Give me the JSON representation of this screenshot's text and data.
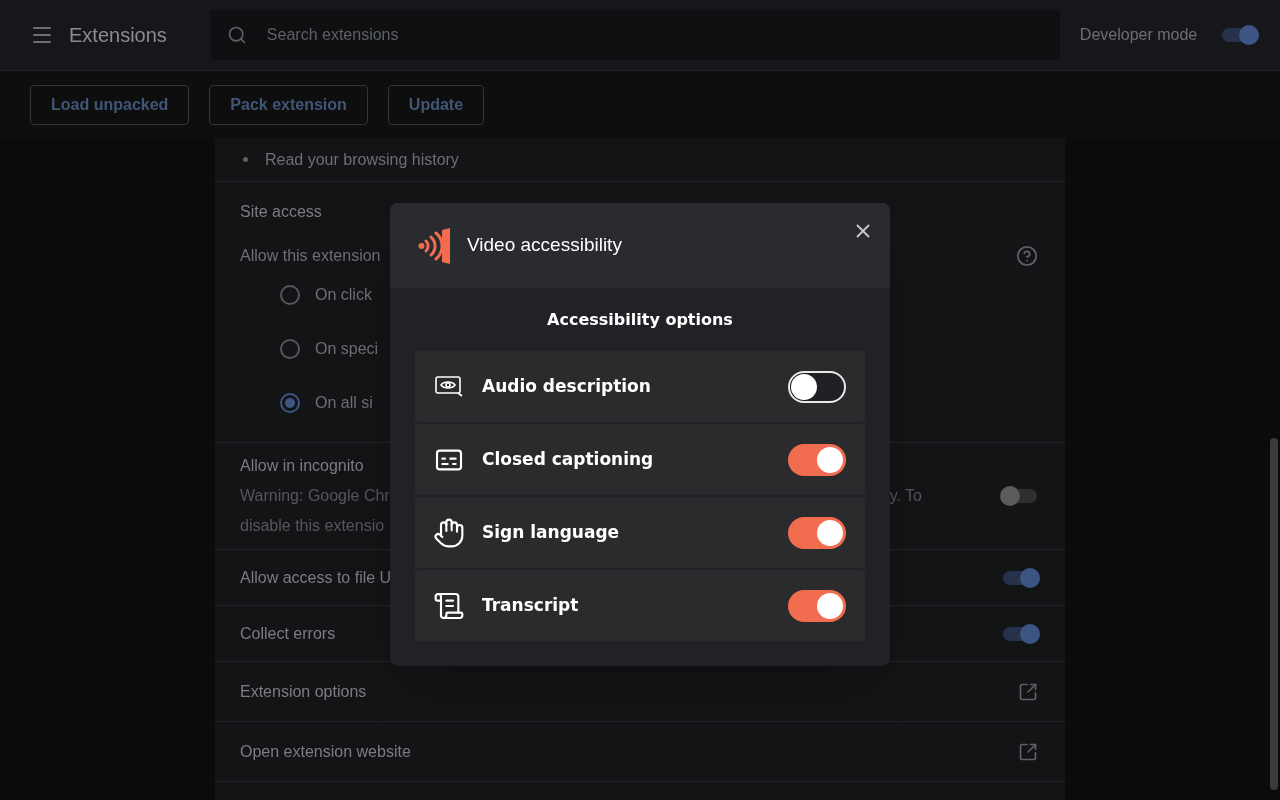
{
  "header": {
    "title": "Extensions",
    "search": {
      "placeholder": "Search extensions"
    },
    "developer_mode": {
      "label": "Developer mode",
      "on": true
    }
  },
  "toolbar": {
    "buttons": [
      "Load unpacked",
      "Pack extension",
      "Update"
    ]
  },
  "details": {
    "permissions": [
      "Read your browsing history"
    ],
    "site_access": {
      "title": "Site access",
      "prompt": "Allow this extension",
      "options": [
        {
          "label": "On click",
          "selected": false
        },
        {
          "label": "On speci",
          "selected": false
        },
        {
          "label": "On all si",
          "selected": true
        }
      ]
    },
    "settings": [
      {
        "kind": "toggle",
        "title": "Allow in incognito",
        "description": {
          "line_1": "Warning: Google Chr",
          "line_1_end": "y. To",
          "line_2": "disable this extensio"
        },
        "on": false
      },
      {
        "kind": "toggle",
        "title": "Allow access to file U",
        "on": true
      },
      {
        "kind": "toggle",
        "title": "Collect errors",
        "on": true
      },
      {
        "kind": "link",
        "title": "Extension options"
      },
      {
        "kind": "link",
        "title": "Open extension website"
      }
    ]
  },
  "dialog": {
    "title": "Video accessibility",
    "heading": "Accessibility options",
    "options": [
      {
        "kind": "audio_description",
        "label": "Audio description",
        "on": false
      },
      {
        "kind": "captions",
        "label": "Closed captioning",
        "on": true
      },
      {
        "kind": "sign_language",
        "label": "Sign language",
        "on": true
      },
      {
        "kind": "transcript",
        "label": "Transcript",
        "on": true
      }
    ]
  }
}
